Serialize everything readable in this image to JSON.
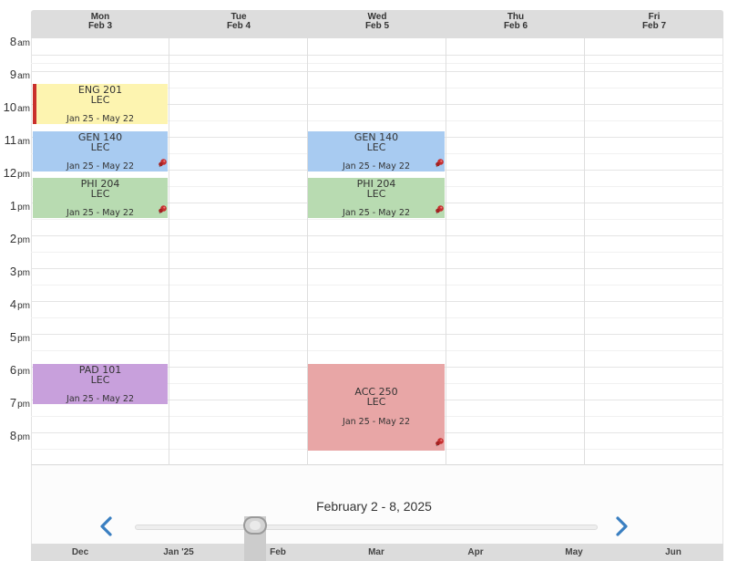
{
  "days": [
    {
      "name": "Mon",
      "date": "Feb 3"
    },
    {
      "name": "Tue",
      "date": "Feb 4"
    },
    {
      "name": "Wed",
      "date": "Feb 5"
    },
    {
      "name": "Thu",
      "date": "Feb 6"
    },
    {
      "name": "Fri",
      "date": "Feb 7"
    }
  ],
  "times": [
    {
      "h": "8",
      "ap": "am"
    },
    {
      "h": "9",
      "ap": "am"
    },
    {
      "h": "10",
      "ap": "am"
    },
    {
      "h": "11",
      "ap": "am"
    },
    {
      "h": "12",
      "ap": "pm"
    },
    {
      "h": "1",
      "ap": "pm"
    },
    {
      "h": "2",
      "ap": "pm"
    },
    {
      "h": "3",
      "ap": "pm"
    },
    {
      "h": "4",
      "ap": "pm"
    },
    {
      "h": "5",
      "ap": "pm"
    },
    {
      "h": "6",
      "ap": "pm"
    },
    {
      "h": "7",
      "ap": "pm"
    },
    {
      "h": "8",
      "ap": "pm"
    }
  ],
  "events": [
    {
      "course": "ENG 201",
      "type": "LEC",
      "dates": "Jan 25 - May 22",
      "color": "#fdf4b0",
      "accent": "#c9302c",
      "pinned": false
    },
    {
      "course": "GEN 140",
      "type": "LEC",
      "dates": "Jan 25 - May 22",
      "color": "#a8cbf1",
      "pinned": true
    },
    {
      "course": "PHI 204",
      "type": "LEC",
      "dates": "Jan 25 - May 22",
      "color": "#b8dbb1",
      "pinned": true
    },
    {
      "course": "PAD 101",
      "type": "LEC",
      "dates": "Jan 25 - May 22",
      "color": "#c8a0dc",
      "pinned": false
    },
    {
      "course": "GEN 140",
      "type": "LEC",
      "dates": "Jan 25 - May 22",
      "color": "#a8cbf1",
      "pinned": true
    },
    {
      "course": "PHI 204",
      "type": "LEC",
      "dates": "Jan 25 - May 22",
      "color": "#b8dbb1",
      "pinned": true
    },
    {
      "course": "ACC 250",
      "type": "LEC",
      "dates": "Jan 25 - May 22",
      "color": "#e8a6a6",
      "pinned": true
    }
  ],
  "nav": {
    "range_label": "February 2 - 8, 2025",
    "prev_icon": "chevron-left-icon",
    "next_icon": "chevron-right-icon",
    "arrow_color": "#3a7fc1"
  },
  "months": [
    "Dec",
    "Jan '25",
    "Feb",
    "Mar",
    "Apr",
    "May",
    "Jun"
  ]
}
